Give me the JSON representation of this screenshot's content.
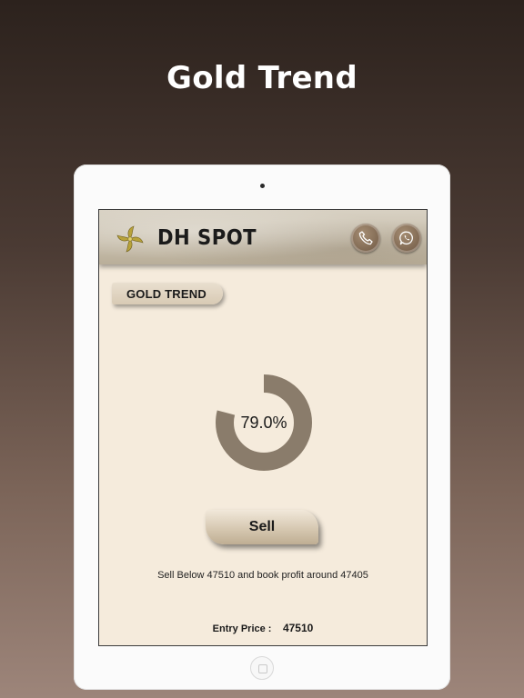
{
  "promo": {
    "title": "Gold Trend"
  },
  "app": {
    "brand": "DH SPOT",
    "section_tag": "GOLD TREND",
    "gauge": {
      "value": 79.0,
      "label": "79.0%"
    },
    "action_button": "Sell",
    "advice": "Sell Below 47510 and book profit around 47405",
    "entry": {
      "label": "Entry Price :",
      "value": "47510"
    },
    "icons": {
      "logo": "gold-pinwheel-logo-icon",
      "phone": "phone-icon",
      "whatsapp": "whatsapp-icon",
      "home": "home-button-icon"
    }
  },
  "colors": {
    "background_top": "#2c221d",
    "background_bottom": "#9d857a",
    "screen_bg": "#f5ebdc",
    "gauge_fill": "#8a7c6b",
    "gauge_track": "#f5ebdc",
    "button_brown": "#7d6650"
  }
}
